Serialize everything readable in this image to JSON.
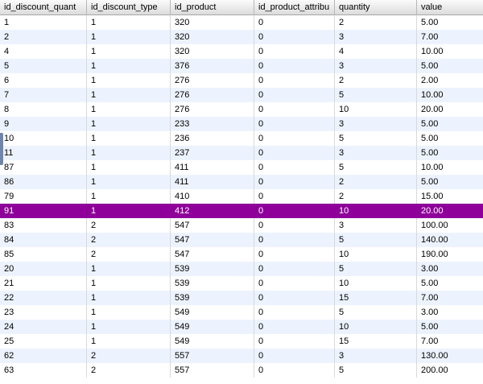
{
  "table": {
    "columns": [
      "id_discount_quant",
      "id_discount_type",
      "id_product",
      "id_product_attribu",
      "quantity",
      "value"
    ],
    "rows": [
      [
        "1",
        "1",
        "320",
        "0",
        "2",
        "5.00"
      ],
      [
        "2",
        "1",
        "320",
        "0",
        "3",
        "7.00"
      ],
      [
        "4",
        "1",
        "320",
        "0",
        "4",
        "10.00"
      ],
      [
        "5",
        "1",
        "376",
        "0",
        "3",
        "5.00"
      ],
      [
        "6",
        "1",
        "276",
        "0",
        "2",
        "2.00"
      ],
      [
        "7",
        "1",
        "276",
        "0",
        "5",
        "10.00"
      ],
      [
        "8",
        "1",
        "276",
        "0",
        "10",
        "20.00"
      ],
      [
        "9",
        "1",
        "233",
        "0",
        "3",
        "5.00"
      ],
      [
        "10",
        "1",
        "236",
        "0",
        "5",
        "5.00"
      ],
      [
        "11",
        "1",
        "237",
        "0",
        "3",
        "5.00"
      ],
      [
        "87",
        "1",
        "411",
        "0",
        "5",
        "10.00"
      ],
      [
        "86",
        "1",
        "411",
        "0",
        "2",
        "5.00"
      ],
      [
        "79",
        "1",
        "410",
        "0",
        "2",
        "15.00"
      ],
      [
        "91",
        "1",
        "412",
        "0",
        "10",
        "20.00"
      ],
      [
        "83",
        "2",
        "547",
        "0",
        "3",
        "100.00"
      ],
      [
        "84",
        "2",
        "547",
        "0",
        "5",
        "140.00"
      ],
      [
        "85",
        "2",
        "547",
        "0",
        "10",
        "190.00"
      ],
      [
        "20",
        "1",
        "539",
        "0",
        "5",
        "3.00"
      ],
      [
        "21",
        "1",
        "539",
        "0",
        "10",
        "5.00"
      ],
      [
        "22",
        "1",
        "539",
        "0",
        "15",
        "7.00"
      ],
      [
        "23",
        "1",
        "549",
        "0",
        "5",
        "3.00"
      ],
      [
        "24",
        "1",
        "549",
        "0",
        "10",
        "5.00"
      ],
      [
        "25",
        "1",
        "549",
        "0",
        "15",
        "7.00"
      ],
      [
        "62",
        "2",
        "557",
        "0",
        "3",
        "130.00"
      ],
      [
        "63",
        "2",
        "557",
        "0",
        "5",
        "200.00"
      ]
    ],
    "selected_row_index": 13,
    "colors": {
      "selected_row": "#8e0099",
      "alt_row": "#edf3fe"
    }
  }
}
